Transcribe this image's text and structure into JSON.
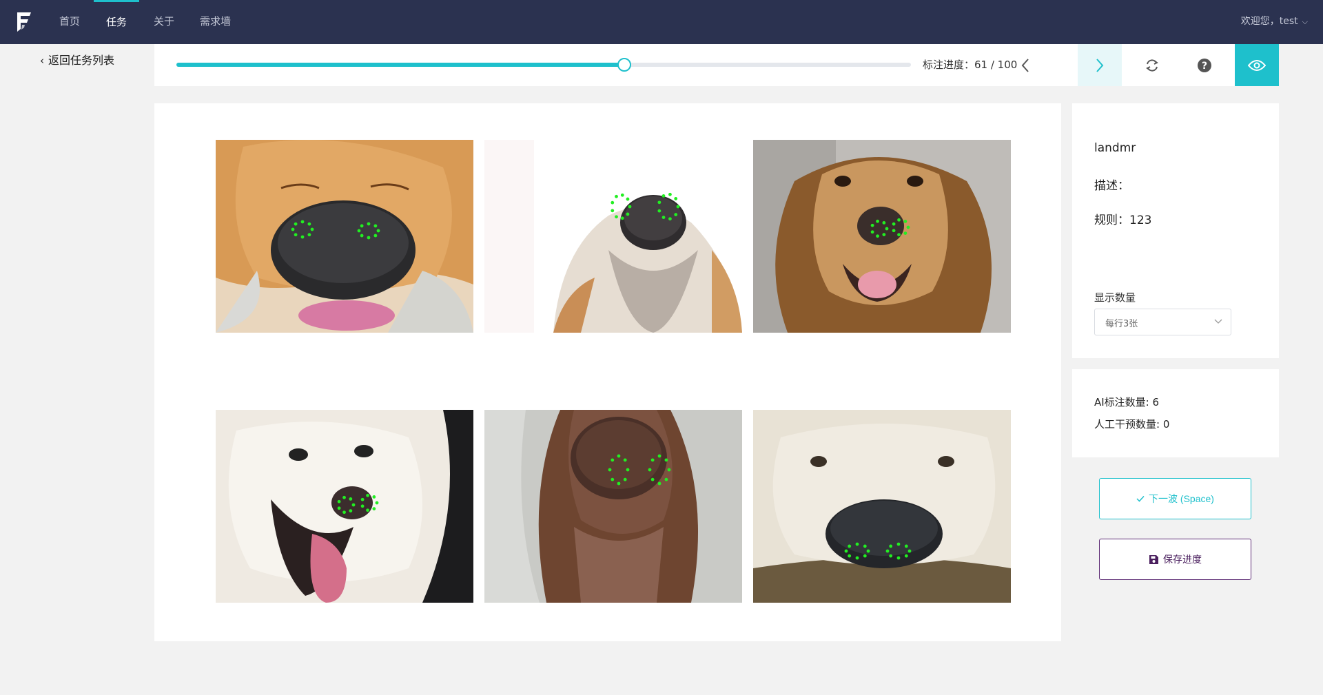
{
  "nav": {
    "items": [
      {
        "label": "首页",
        "active": false
      },
      {
        "label": "任务",
        "active": true
      },
      {
        "label": "关于",
        "active": false
      },
      {
        "label": "需求墙",
        "active": false
      }
    ],
    "welcome": "欢迎您，test"
  },
  "back_label": "返回任务列表",
  "toolbar": {
    "progress_label": "标注进度：61 / 100",
    "progress_value": 61,
    "progress_total": 100,
    "icons": [
      "chevron-left-icon",
      "chevron-right-icon",
      "refresh-icon",
      "help-icon",
      "eye-icon"
    ]
  },
  "task": {
    "name": "landmr",
    "description": "描述：",
    "rule": "规则：123",
    "display_count_label": "显示数量",
    "display_count_value": "每行3张"
  },
  "stats": {
    "ai_count": "AI标注数量: 6",
    "manual_count": "人工干预数量: 0"
  },
  "actions": {
    "next_batch": "下一波 (Space)",
    "save_progress": "保存进度"
  },
  "images": [
    {
      "subject": "golden retriever sleeping, nose close-up",
      "landmarks": 16
    },
    {
      "subject": "light-coated dog nose from below",
      "landmarks": 18
    },
    {
      "subject": "golden retriever smiling",
      "landmarks": 14
    },
    {
      "subject": "white samoyed with tongue out",
      "landmarks": 14
    },
    {
      "subject": "brown dog nose close-up",
      "landmarks": 16
    },
    {
      "subject": "fluffy cream terrier nose",
      "landmarks": 16
    }
  ],
  "colors": {
    "nav_bg": "#2b3250",
    "accent": "#1ec0cc",
    "save_border": "#5c2a74",
    "landmark": "#22ee22"
  }
}
